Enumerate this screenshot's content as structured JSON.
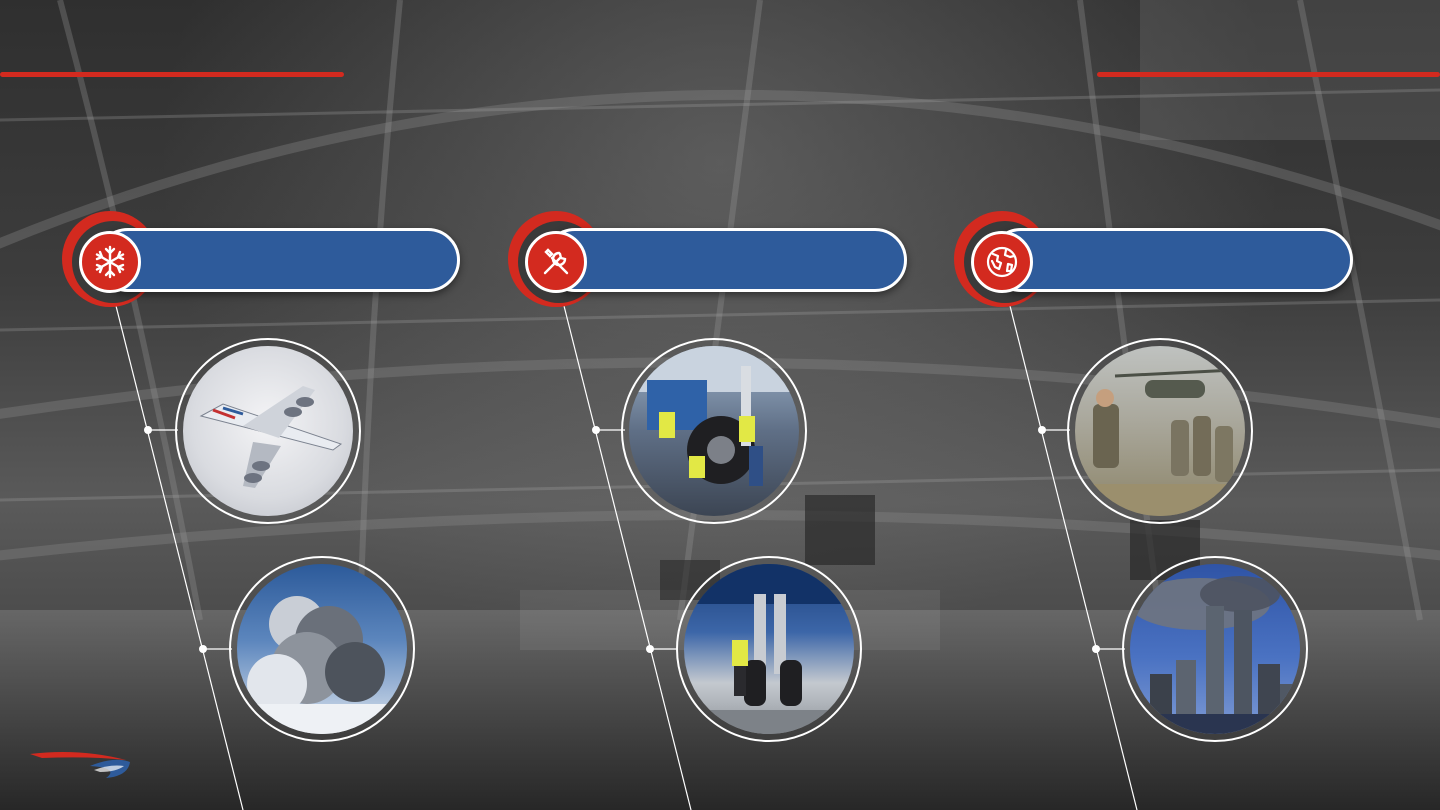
{
  "brand": {
    "accent_red": "#d32a1f",
    "accent_blue": "#2e5b9b",
    "logo": "speedmarque-logo"
  },
  "panels": [
    {
      "id": "weather",
      "icon": "snowflake-icon",
      "label": "",
      "photos": [
        {
          "name": "photo-aircraft-in-snow"
        },
        {
          "name": "photo-volcanic-ash-cloud"
        }
      ]
    },
    {
      "id": "engineering",
      "icon": "tools-icon",
      "label": "",
      "photos": [
        {
          "name": "photo-engineers-at-landing-gear"
        },
        {
          "name": "photo-engineer-under-aircraft"
        }
      ]
    },
    {
      "id": "global-events",
      "icon": "globe-icon",
      "label": "",
      "photos": [
        {
          "name": "photo-soldiers-and-helicopter"
        },
        {
          "name": "photo-city-skyline-smoke"
        }
      ]
    }
  ]
}
